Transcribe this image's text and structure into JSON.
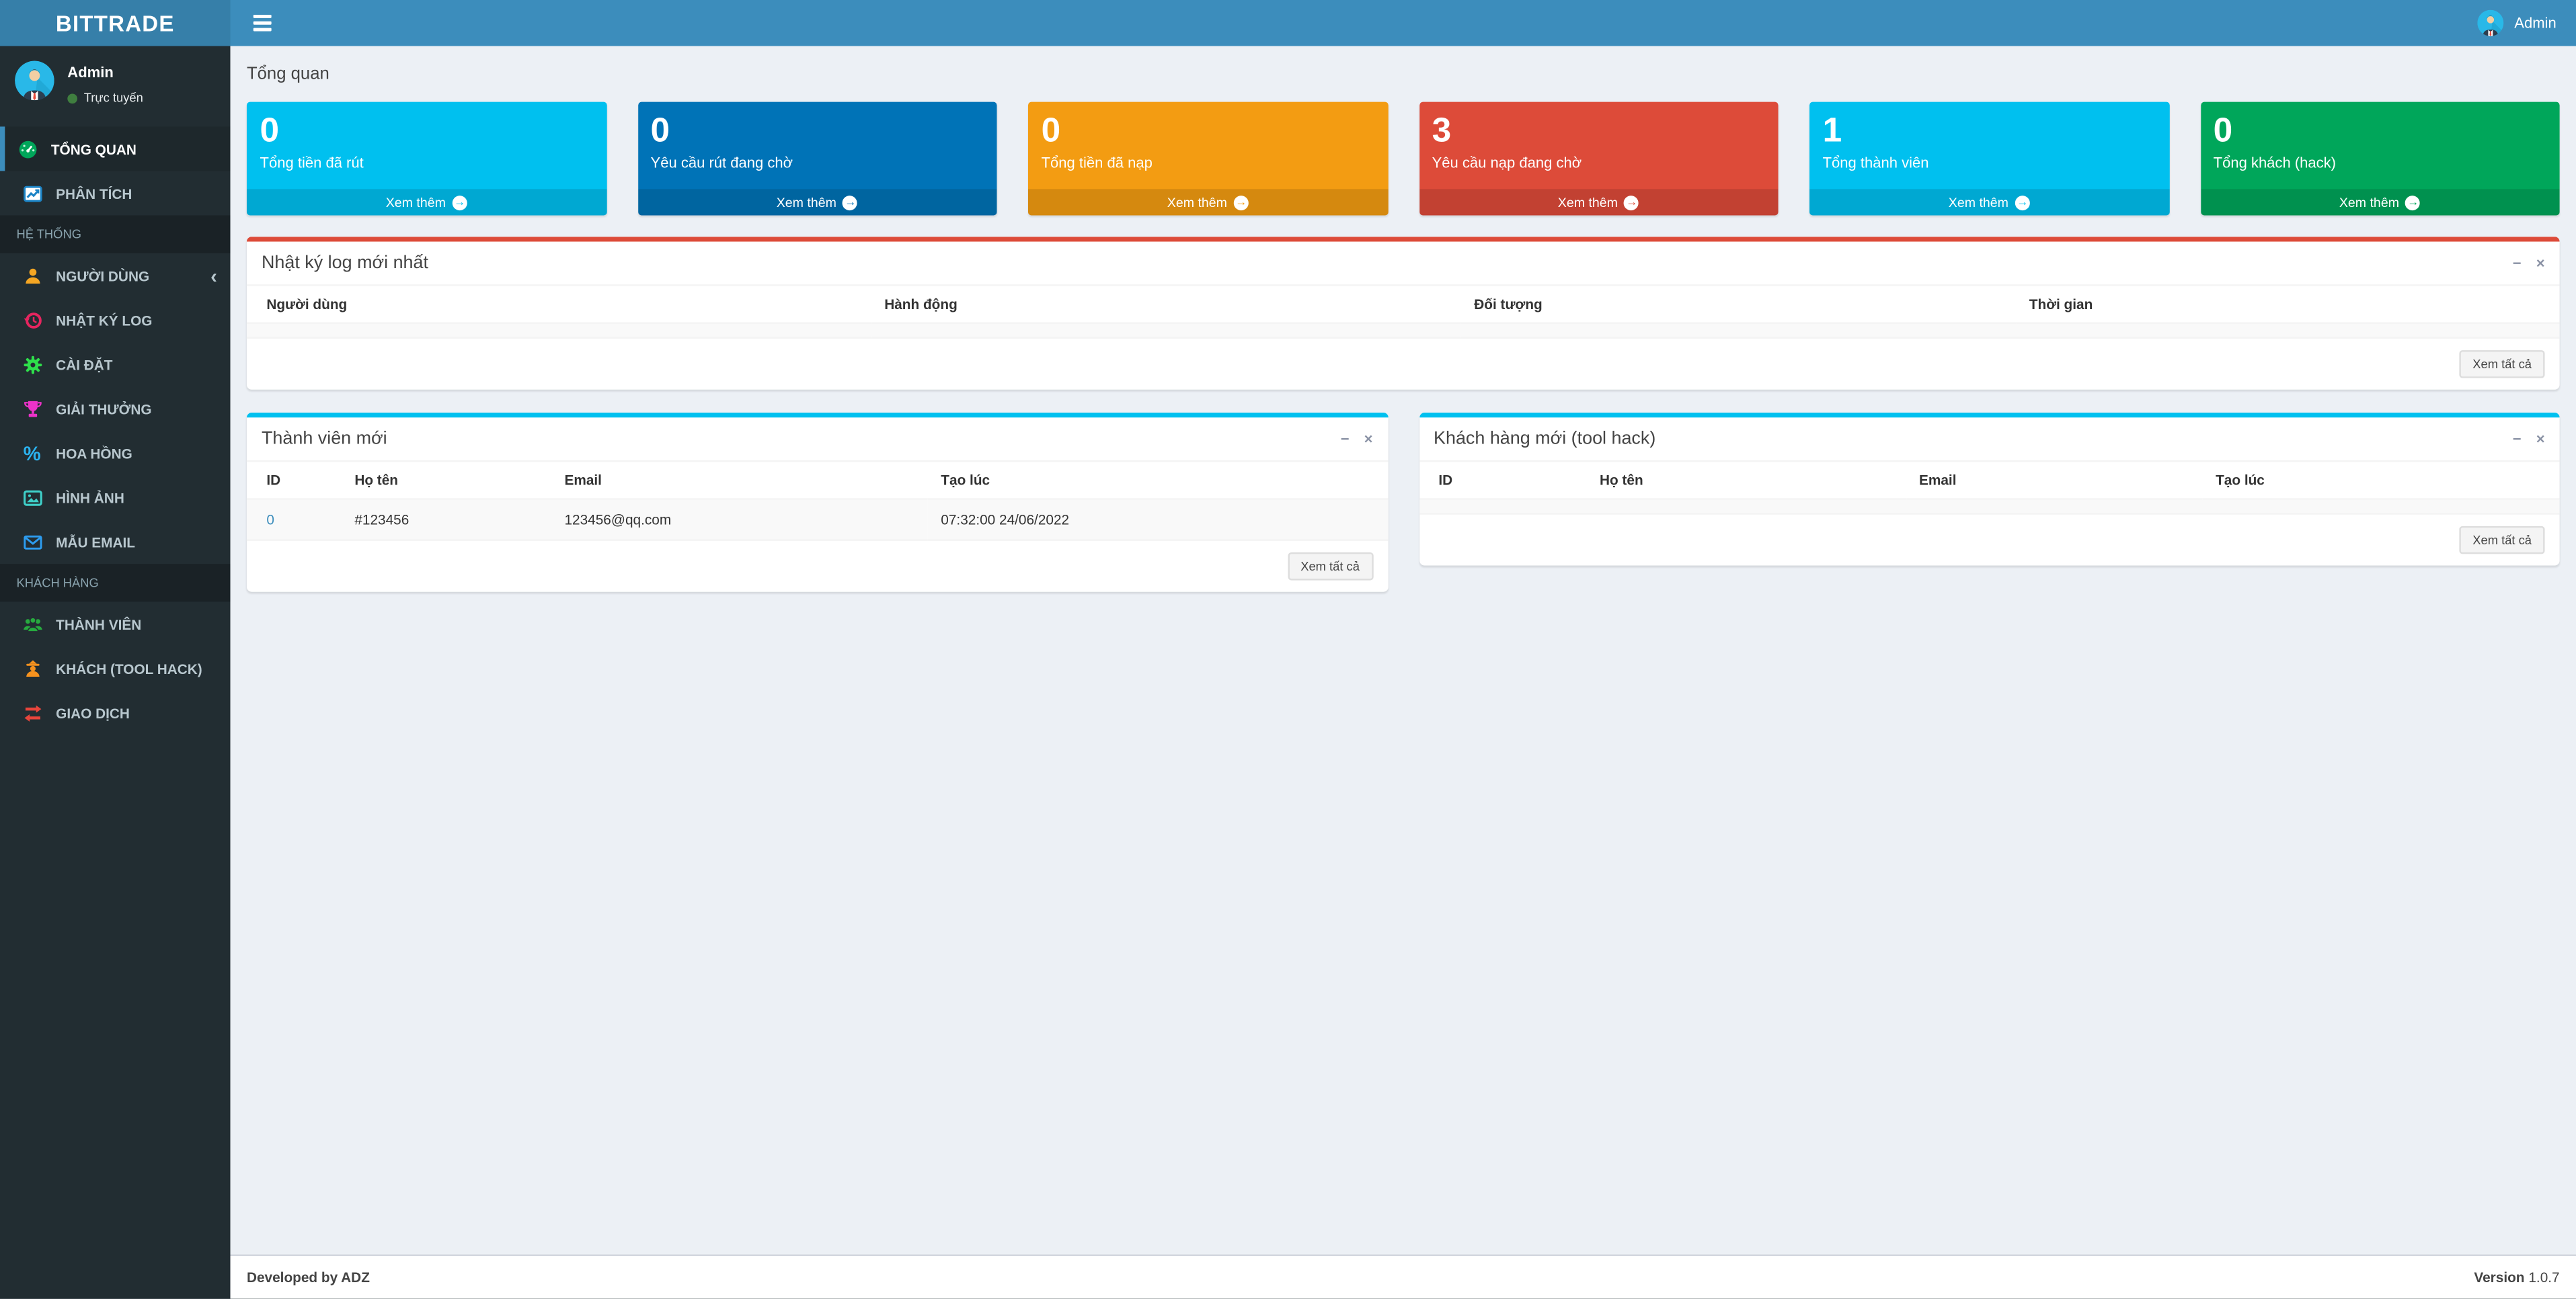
{
  "header": {
    "logo": "BITTRADE",
    "user": "Admin"
  },
  "icons": {
    "minimize": "−",
    "close": "×",
    "chevron_left": "‹",
    "arrow_right": "→",
    "percent": "%"
  },
  "sidebar": {
    "user": {
      "name": "Admin",
      "status": "Trực tuyến"
    },
    "sections": [
      {
        "items": [
          {
            "label": "TỔNG QUAN"
          },
          {
            "label": "PHÂN TÍCH"
          }
        ]
      },
      {
        "header": "HỆ THỐNG",
        "items": [
          {
            "label": "NGƯỜI DÙNG"
          },
          {
            "label": "NHẬT KÝ LOG"
          },
          {
            "label": "CÀI ĐẶT"
          },
          {
            "label": "GIẢI THƯỞNG"
          },
          {
            "label": "HOA HỒNG"
          },
          {
            "label": "HÌNH ẢNH"
          },
          {
            "label": "MẪU EMAIL"
          }
        ]
      },
      {
        "header": "KHÁCH HÀNG",
        "items": [
          {
            "label": "THÀNH VIÊN"
          },
          {
            "label": "KHÁCH (TOOL HACK)"
          },
          {
            "label": "GIAO DỊCH"
          }
        ]
      }
    ]
  },
  "content": {
    "page_title": "Tổng quan",
    "info_boxes": [
      {
        "value": "0",
        "label": "Tổng tiền đã rút",
        "more": "Xem thêm",
        "color": "#00c0ef"
      },
      {
        "value": "0",
        "label": "Yêu cầu rút đang chờ",
        "more": "Xem thêm",
        "color": "#0073b7"
      },
      {
        "value": "0",
        "label": "Tổng tiền đã nạp",
        "more": "Xem thêm",
        "color": "#f39c12"
      },
      {
        "value": "3",
        "label": "Yêu cầu nạp đang chờ",
        "more": "Xem thêm",
        "color": "#dd4b39"
      },
      {
        "value": "1",
        "label": "Tổng thành viên",
        "more": "Xem thêm",
        "color": "#00c0ef"
      },
      {
        "value": "0",
        "label": "Tổng khách (hack)",
        "more": "Xem thêm",
        "color": "#00a65a"
      }
    ],
    "log_panel": {
      "title": "Nhật ký log mới nhất",
      "accent": "#dd4b39",
      "columns": [
        "Người dùng",
        "Hành động",
        "Đối tượng",
        "Thời gian"
      ],
      "footer_button": "Xem tất cả"
    },
    "members_panel": {
      "title": "Thành viên mới",
      "accent": "#00c0ef",
      "columns": [
        "ID",
        "Họ tên",
        "Email",
        "Tạo lúc"
      ],
      "rows": [
        {
          "id": "0",
          "name": "#123456",
          "email": "123456@qq.com",
          "created": "07:32:00 24/06/2022"
        }
      ],
      "footer_button": "Xem tất cả"
    },
    "customers_panel": {
      "title": "Khách hàng mới (tool hack)",
      "accent": "#00c0ef",
      "columns": [
        "ID",
        "Họ tên",
        "Email",
        "Tạo lúc"
      ],
      "footer_button": "Xem tất cả"
    }
  },
  "footer": {
    "left": "Developed by ADZ",
    "version_label": "Version",
    "version": "1.0.7"
  }
}
